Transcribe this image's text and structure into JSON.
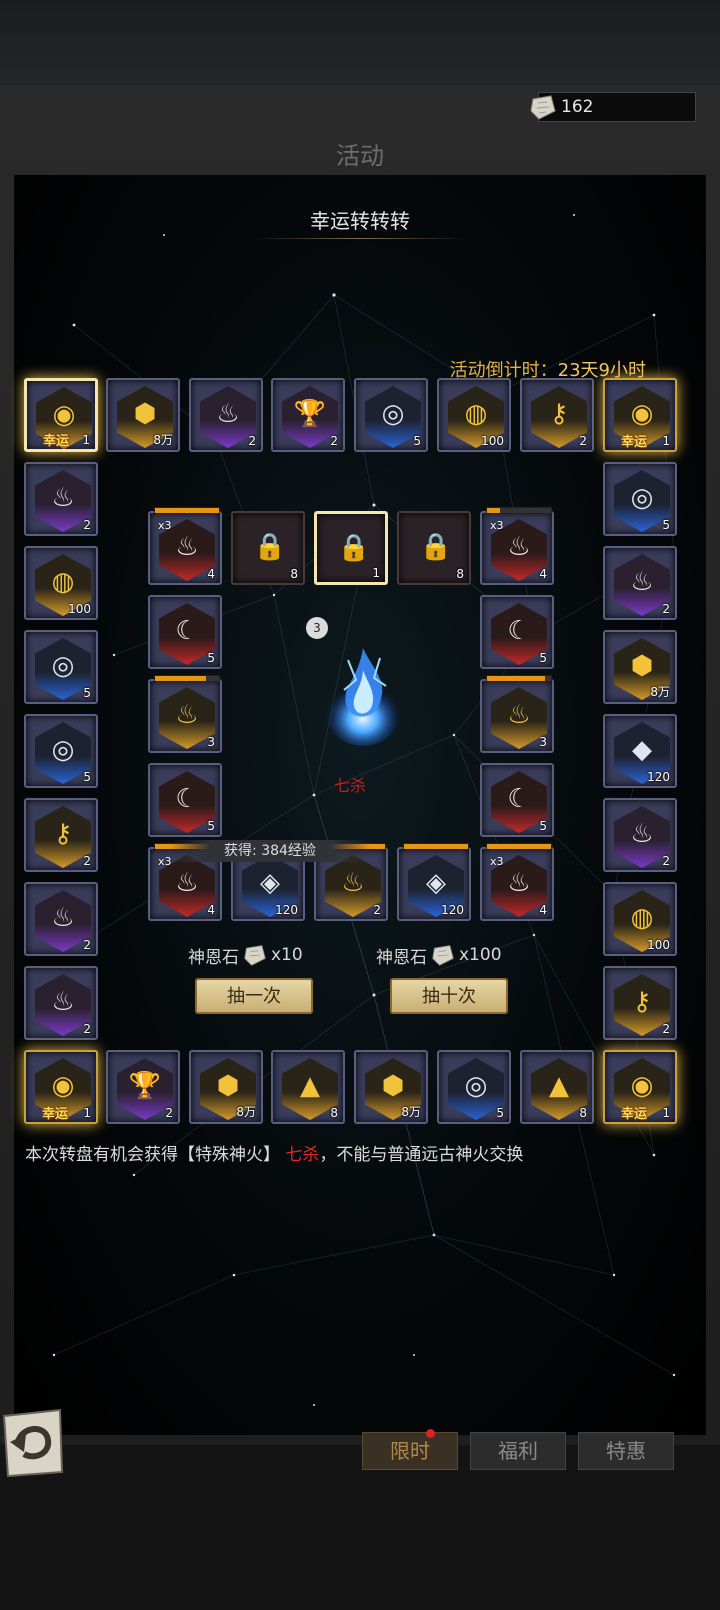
{
  "currency": {
    "amount": "162",
    "icon": "shenen-stone-icon"
  },
  "page_title": "活动",
  "event_title": "幸运转转转",
  "countdown": {
    "label": "活动倒计时：",
    "value": "23天9小时"
  },
  "lucky_tag": "幸运",
  "ring": {
    "top": [
      {
        "icon": "lucky-orb-icon",
        "glyph": "◉",
        "color": "gold",
        "count": "1",
        "lucky": true,
        "selected": true
      },
      {
        "icon": "gold-gem-icon",
        "glyph": "⬢",
        "color": "gold",
        "count": "8万"
      },
      {
        "icon": "flame-emblem-icon",
        "glyph": "♨",
        "color": "purple",
        "count": "2"
      },
      {
        "icon": "chalice-icon",
        "glyph": "🏆",
        "color": "purple",
        "count": "2"
      },
      {
        "icon": "compass-disc-icon",
        "glyph": "◎",
        "color": "blue",
        "count": "5"
      },
      {
        "icon": "pouch-icon",
        "glyph": "◍",
        "color": "gold",
        "count": "100"
      },
      {
        "icon": "scroll-key-icon",
        "glyph": "⚷",
        "color": "gold",
        "count": "2"
      },
      {
        "icon": "lucky-orb-icon",
        "glyph": "◉",
        "color": "gold",
        "count": "1",
        "lucky": true
      }
    ],
    "right": [
      {
        "icon": "compass-disc-icon",
        "glyph": "◎",
        "color": "blue",
        "count": "5"
      },
      {
        "icon": "flame-emblem-icon",
        "glyph": "♨",
        "color": "purple",
        "count": "2"
      },
      {
        "icon": "gold-gem-icon",
        "glyph": "⬢",
        "color": "gold",
        "count": "8万"
      },
      {
        "icon": "blue-crystal-icon",
        "glyph": "◆",
        "color": "blue",
        "count": "120"
      },
      {
        "icon": "flame-emblem-icon",
        "glyph": "♨",
        "color": "purple",
        "count": "2"
      },
      {
        "icon": "pouch-icon",
        "glyph": "◍",
        "color": "gold",
        "count": "100"
      },
      {
        "icon": "scroll-key-icon",
        "glyph": "⚷",
        "color": "gold",
        "count": "2"
      }
    ],
    "bottom": [
      {
        "icon": "lucky-orb-icon",
        "glyph": "◉",
        "color": "gold",
        "count": "1",
        "lucky": true
      },
      {
        "icon": "chalice-icon",
        "glyph": "🏆",
        "color": "purple",
        "count": "2"
      },
      {
        "icon": "gold-gem-icon",
        "glyph": "⬢",
        "color": "gold",
        "count": "8万"
      },
      {
        "icon": "dust-pile-icon",
        "glyph": "▲",
        "color": "gold",
        "count": "8"
      },
      {
        "icon": "gold-gem-icon",
        "glyph": "⬢",
        "color": "gold",
        "count": "8万"
      },
      {
        "icon": "compass-disc-icon",
        "glyph": "◎",
        "color": "blue",
        "count": "5"
      },
      {
        "icon": "dust-pile-icon",
        "glyph": "▲",
        "color": "gold",
        "count": "8"
      },
      {
        "icon": "lucky-orb-icon",
        "glyph": "◉",
        "color": "gold",
        "count": "1",
        "lucky": true
      }
    ],
    "left": [
      {
        "icon": "flame-emblem-icon",
        "glyph": "♨",
        "color": "purple",
        "count": "2"
      },
      {
        "icon": "pouch-icon",
        "glyph": "◍",
        "color": "gold",
        "count": "100"
      },
      {
        "icon": "compass-disc-icon",
        "glyph": "◎",
        "color": "blue",
        "count": "5"
      },
      {
        "icon": "compass-disc-icon",
        "glyph": "◎",
        "color": "blue",
        "count": "5"
      },
      {
        "icon": "scroll-key-icon",
        "glyph": "⚷",
        "color": "gold",
        "count": "2"
      },
      {
        "icon": "flame-emblem-icon",
        "glyph": "♨",
        "color": "purple",
        "count": "2"
      },
      {
        "icon": "flame-emblem-icon",
        "glyph": "♨",
        "color": "purple",
        "count": "2"
      }
    ]
  },
  "inner": {
    "top": [
      {
        "icon": "fire-emblem-icon",
        "glyph": "♨",
        "color": "red",
        "count": "4",
        "x3": "x3",
        "progress": 1.0
      },
      {
        "icon": "locked-chest-icon",
        "glyph": "🔒",
        "color": "locked",
        "count": "8",
        "locked": true
      },
      {
        "icon": "locked-chest-icon",
        "glyph": "🔒",
        "color": "locked",
        "count": "1",
        "locked": true,
        "selected": true
      },
      {
        "icon": "locked-chest-icon",
        "glyph": "🔒",
        "color": "locked",
        "count": "8",
        "locked": true
      },
      {
        "icon": "fire-emblem-icon",
        "glyph": "♨",
        "color": "red",
        "count": "4",
        "x3": "x3",
        "progress": 0.2
      }
    ],
    "left": [
      {
        "icon": "moon-fire-icon",
        "glyph": "☾",
        "color": "red",
        "count": "5"
      },
      {
        "icon": "fire-emblem-icon",
        "glyph": "♨",
        "color": "gold",
        "count": "3",
        "progress": 0.8
      },
      {
        "icon": "moon-fire-icon",
        "glyph": "☾",
        "color": "red",
        "count": "5"
      }
    ],
    "right": [
      {
        "icon": "moon-fire-icon",
        "glyph": "☾",
        "color": "red",
        "count": "5"
      },
      {
        "icon": "fire-emblem-icon",
        "glyph": "♨",
        "color": "gold",
        "count": "3",
        "progress": 0.9
      },
      {
        "icon": "moon-fire-icon",
        "glyph": "☾",
        "color": "red",
        "count": "5"
      }
    ],
    "bottom": [
      {
        "icon": "fire-emblem-icon",
        "glyph": "♨",
        "color": "red",
        "count": "4",
        "x3": "x3",
        "progress": 1.0
      },
      {
        "icon": "void-cube-icon",
        "glyph": "◈",
        "color": "blue",
        "count": "120"
      },
      {
        "icon": "fire-emblem-icon",
        "glyph": "♨",
        "color": "gold",
        "count": "2",
        "progress": 1.0
      },
      {
        "icon": "void-cube-icon",
        "glyph": "◈",
        "color": "blue",
        "count": "120",
        "progress": 1.0
      },
      {
        "icon": "fire-emblem-icon",
        "glyph": "♨",
        "color": "red",
        "count": "4",
        "x3": "x3",
        "progress": 1.0
      }
    ]
  },
  "center": {
    "fire_name": "七杀",
    "badge": "3",
    "exp_tip": "获得: 384经验"
  },
  "draw_once": {
    "cost_label": "神恩石",
    "cost_qty": "x10",
    "button": "抽一次"
  },
  "draw_ten": {
    "cost_label": "神恩石",
    "cost_qty": "x100",
    "button": "抽十次"
  },
  "notice": {
    "prefix": "本次转盘有机会获得【特殊神火】",
    "highlight": "七杀",
    "suffix": "，不能与普通远古神火交换"
  },
  "tabs": [
    {
      "label": "限时",
      "active": true,
      "badge": true
    },
    {
      "label": "福利",
      "active": false
    },
    {
      "label": "特惠",
      "active": false
    }
  ],
  "colors": {
    "accent": "#e0b347",
    "highlight_red": "#e02828",
    "frame_purple": "#5a5f82"
  }
}
